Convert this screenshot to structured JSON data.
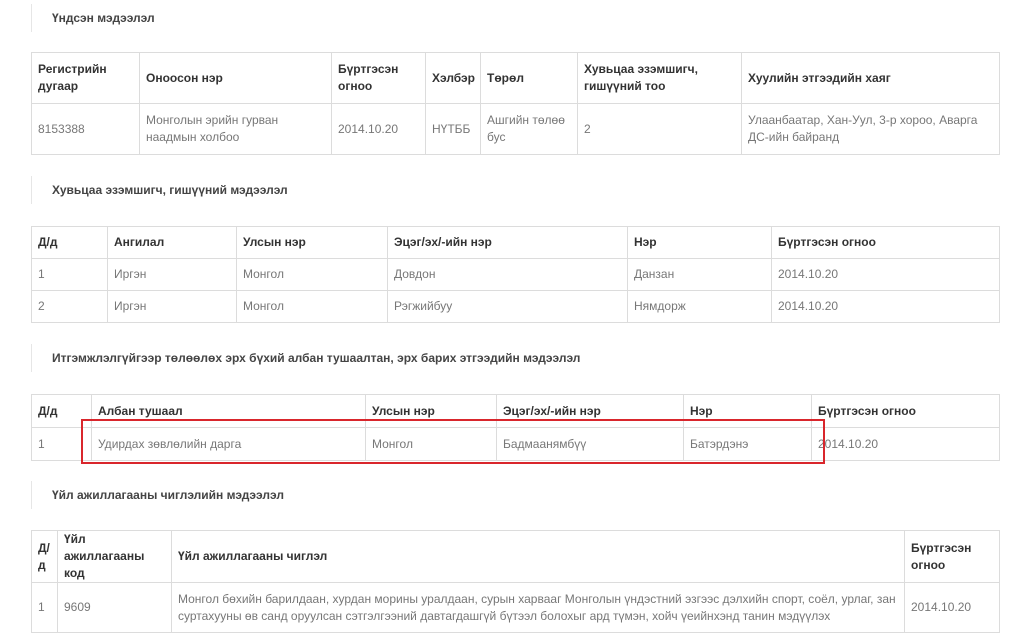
{
  "sections": {
    "basic": {
      "title": "Үндсэн мэдээлэл",
      "headers": [
        "Регистрийн дугаар",
        "Оноосон нэр",
        "Бүртгэсэн огноо",
        "Хэлбэр",
        "Төрөл",
        "Хувьцаа эзэмшигч, гишүүний тоо",
        "Хуулийн этгээдийн хаяг"
      ],
      "rows": [
        [
          "8153388",
          "Монголын эрийн гурван наадмын холбоо",
          "2014.10.20",
          "НҮТББ",
          "Ашгийн төлөө бус",
          "2",
          "Улаанбаатар, Хан-Уул, 3-р хороо, Аварга ДС-ийн байранд"
        ]
      ]
    },
    "shareholders": {
      "title": "Хувьцаа эзэмшигч, гишүүний мэдээлэл",
      "headers": [
        "Д/д",
        "Ангилал",
        "Улсын нэр",
        "Эцэг/эх/-ийн нэр",
        "Нэр",
        "Бүртгэсэн огноо"
      ],
      "rows": [
        [
          "1",
          "Иргэн",
          "Монгол",
          "Довдон",
          "Данзан",
          "2014.10.20"
        ],
        [
          "2",
          "Иргэн",
          "Монгол",
          "Рэгжийбуу",
          "Нямдорж",
          "2014.10.20"
        ]
      ]
    },
    "officials": {
      "title": "Итгэмжлэлгүйгээр төлөөлөх эрх бүхий албан тушаалтан, эрх барих этгээдийн мэдээлэл",
      "headers": [
        "Д/д",
        "Албан тушаал",
        "Улсын нэр",
        "Эцэг/эх/-ийн нэр",
        "Нэр",
        "Бүртгэсэн огноо"
      ],
      "rows": [
        [
          "1",
          "Удирдах зөвлөлийн дарга",
          "Монгол",
          "Бадмаанямбүү",
          "Батэрдэнэ",
          "2014.10.20"
        ]
      ]
    },
    "activities": {
      "title": "Үйл ажиллагааны чиглэлийн мэдээлэл",
      "headers": [
        "Д/д",
        "Үйл ажиллагааны код",
        "Үйл ажиллагааны чиглэл",
        "Бүртгэсэн огноо"
      ],
      "rows": [
        [
          "1",
          "9609",
          "Монгол бөхийн барилдаан, хурдан морины уралдаан, сурын харвааг Монголын үндэстний эзгээс дэлхийн спорт, соёл, урлаг, зан суртахууны өв санд оруулсан сэтгэлгээний давтагдашгүй бүтээл болохыг ард түмэн, хойч үеийнхэнд танин мэдүүлэх",
          "2014.10.20"
        ]
      ]
    }
  },
  "colors": {
    "highlight": "#d9262c",
    "border": "#dcdcdc"
  }
}
